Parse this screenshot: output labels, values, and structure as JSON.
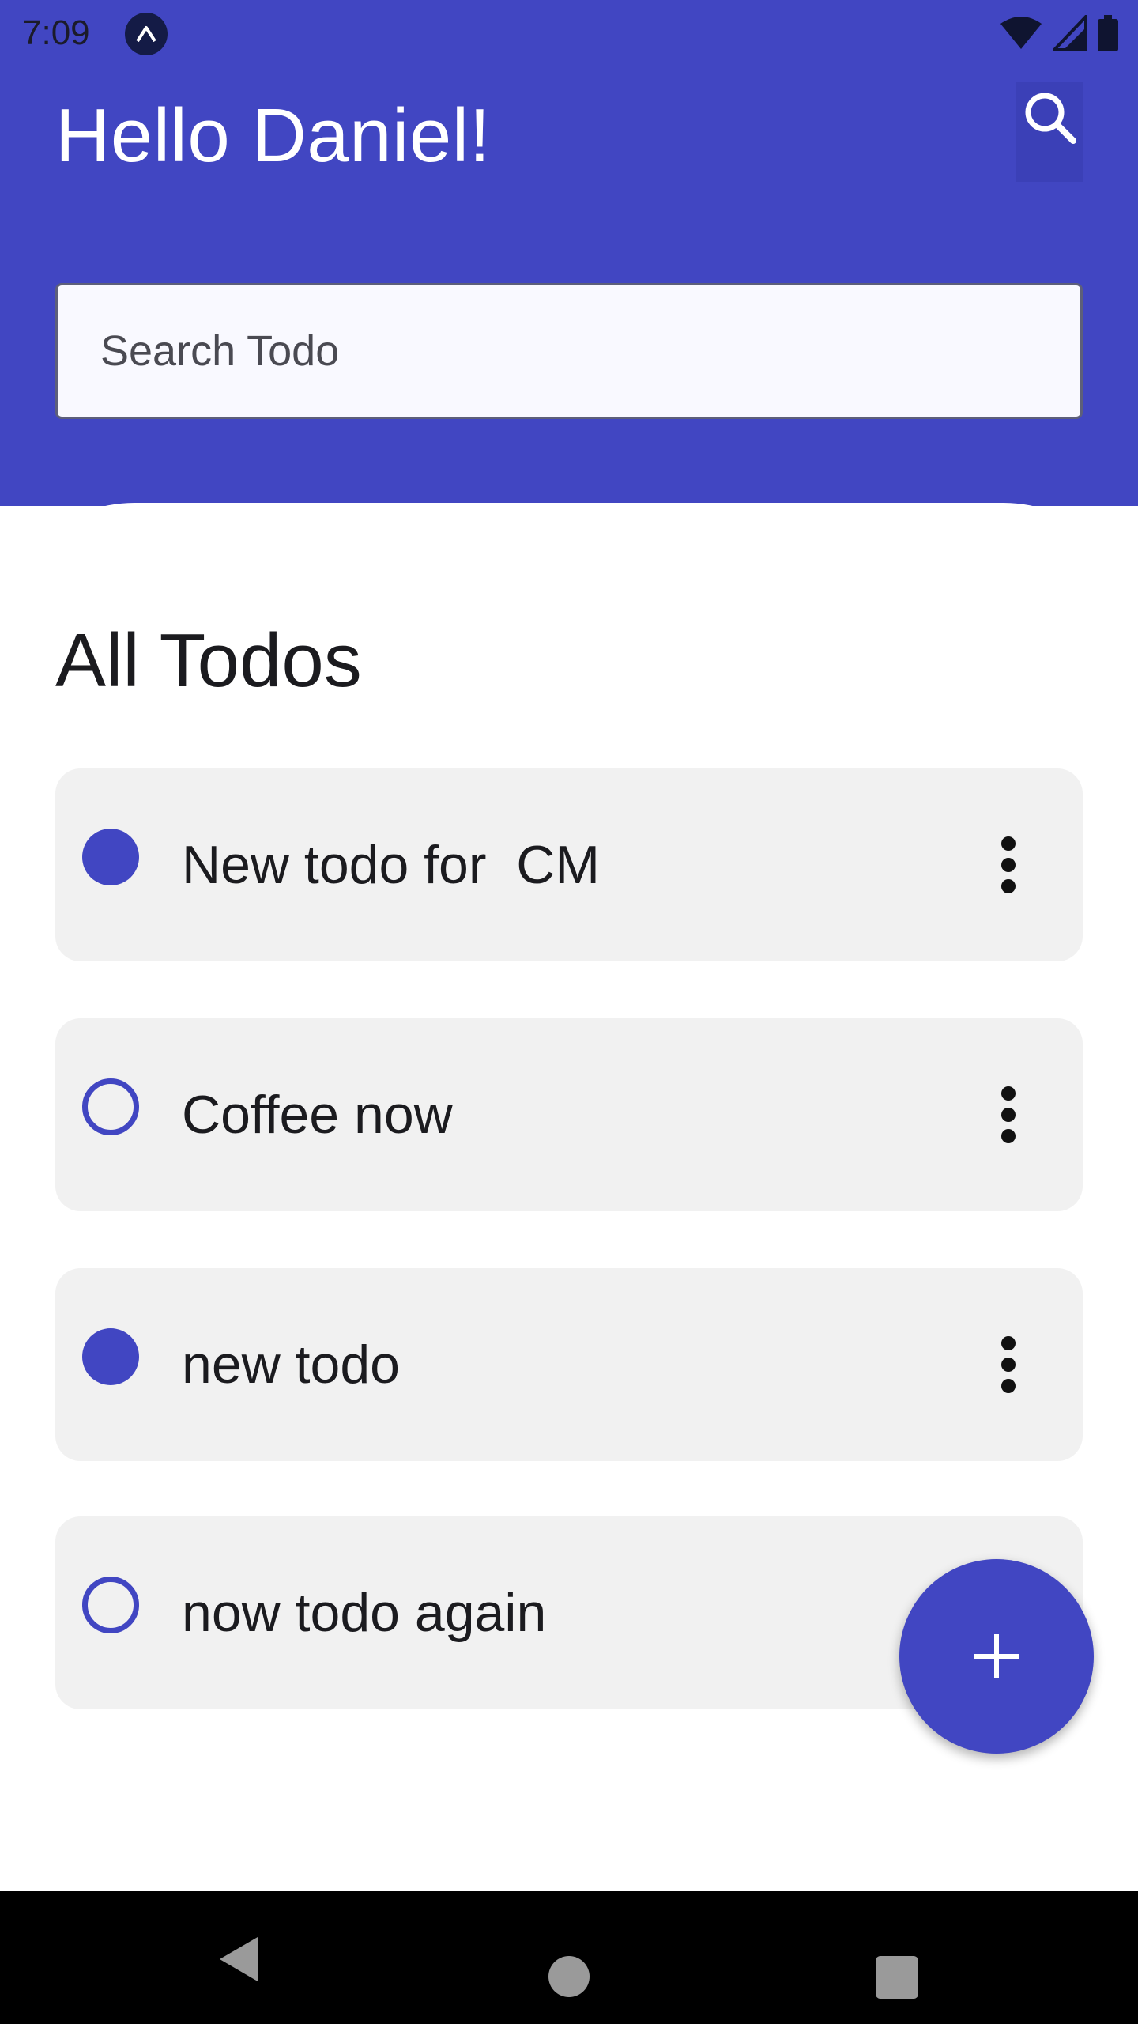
{
  "status_bar": {
    "time": "7:09",
    "app_icon": "expo-icon",
    "indicators": [
      "wifi-icon",
      "cell-signal-icon",
      "battery-icon"
    ]
  },
  "header": {
    "greeting": "Hello Daniel!",
    "search_icon": "search-icon"
  },
  "search": {
    "placeholder": "Search Todo",
    "value": ""
  },
  "section": {
    "title": "All Todos"
  },
  "todos": [
    {
      "text": "New todo for  CM",
      "completed": true
    },
    {
      "text": "Coffee now",
      "completed": false
    },
    {
      "text": "new todo",
      "completed": true
    },
    {
      "text": "now todo again",
      "completed": false
    }
  ],
  "fab": {
    "icon": "plus-icon"
  },
  "nav": {
    "back": "back-icon",
    "home": "home-icon",
    "recents": "recents-icon"
  },
  "colors": {
    "primary": "#4146C2",
    "card": "#f1f1f1",
    "text": "#1b1b1f",
    "navbar": "#000000"
  }
}
